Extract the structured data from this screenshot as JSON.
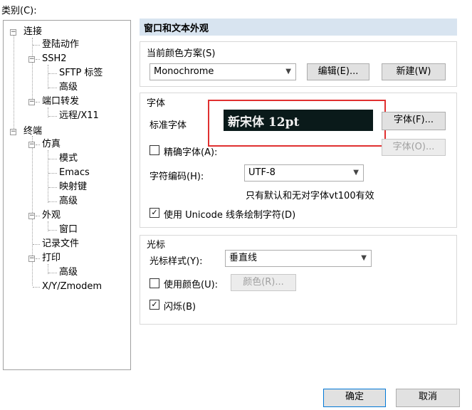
{
  "category_label": "类别(C):",
  "tree": {
    "connection": "连接",
    "login_actions": "登陆动作",
    "ssh2": "SSH2",
    "sftp_tab": "SFTP 标签",
    "ssh2_advanced": "高级",
    "port_forwarding": "端口转发",
    "remote_x11": "远程/X11",
    "terminal": "终端",
    "emulation": "仿真",
    "modes": "模式",
    "emacs": "Emacs",
    "mapped_keys": "映射键",
    "emulation_advanced": "高级",
    "appearance": "外观",
    "window": "窗口",
    "log_file": "记录文件",
    "printing": "打印",
    "printing_advanced": "高级",
    "xyzmodem": "X/Y/Zmodem"
  },
  "section_title": "窗口和文本外观",
  "color_scheme": {
    "label": "当前颜色方案(S)",
    "value": "Monochrome",
    "edit_button": "编辑(E)...",
    "new_button": "新建(W)"
  },
  "font_group": {
    "title": "字体",
    "standard_font_label": "标准字体",
    "preview_text": "新宋体  12pt",
    "font_button": "字体(F)...",
    "precise_font_label": "精确字体(A):",
    "precise_font_checked": false,
    "precise_font_button": "字体(O)...",
    "encoding_label": "字符编码(H):",
    "encoding_value": "UTF-8",
    "encoding_note": "只有默认和无对字体vt100有效",
    "unicode_lines_label": "使用 Unicode 线条绘制字符(D)",
    "unicode_lines_checked": true
  },
  "cursor_group": {
    "title": "光标",
    "style_label": "光标样式(Y):",
    "style_value": "垂直线",
    "use_color_label": "使用颜色(U):",
    "use_color_checked": false,
    "color_button": "颜色(R)...",
    "blink_label": "闪烁(B)",
    "blink_checked": true
  },
  "footer": {
    "ok_button": "确定",
    "cancel_button": "取消"
  },
  "colors": {
    "header_bg": "#d8e4f0",
    "preview_bg": "#0a1a1a",
    "highlight": "#e03030",
    "primary_border": "#0078d7"
  }
}
